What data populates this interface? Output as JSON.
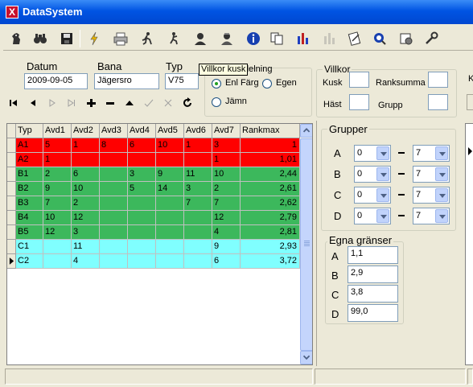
{
  "window": {
    "title": "DataSystem",
    "app_icon": "X"
  },
  "toolbar": {
    "buttons": [
      {
        "icon": "horse-icon",
        "enabled": true
      },
      {
        "icon": "binoculars-icon",
        "enabled": true
      },
      {
        "icon": "save-icon",
        "enabled": true
      },
      {
        "icon": "lightning-icon",
        "enabled": true
      },
      {
        "icon": "printer-icon",
        "enabled": true
      },
      {
        "icon": "runner-icon",
        "enabled": true
      },
      {
        "icon": "runner2-icon",
        "enabled": true
      },
      {
        "icon": "person-icon",
        "enabled": true
      },
      {
        "icon": "person2-icon",
        "enabled": true
      },
      {
        "icon": "info-icon",
        "enabled": true
      },
      {
        "icon": "copy-icon",
        "enabled": true
      },
      {
        "icon": "bar-chart-icon",
        "enabled": true
      },
      {
        "icon": "bar-chart-disabled-icon",
        "enabled": false
      },
      {
        "icon": "edit-doc-icon",
        "enabled": true
      },
      {
        "icon": "search-web-icon",
        "enabled": true
      },
      {
        "icon": "settings-doc-icon",
        "enabled": true
      },
      {
        "icon": "tools-icon",
        "enabled": true
      }
    ]
  },
  "form": {
    "datum_label": "Datum",
    "datum_value": "2009-09-05",
    "bana_label": "Bana",
    "bana_value": "Jägersro",
    "typ_label": "Typ",
    "typ_value": "V75",
    "fordelning_label": "delning",
    "radio_enl_farg": "Enl Färg",
    "radio_egen": "Egen",
    "radio_jamn": "Jämn",
    "tooltip": "Villkor kusk"
  },
  "villkor": {
    "title": "Villkor",
    "kusk": "Kusk",
    "ranksumma": "Ranksumma",
    "hast": "Häst",
    "grupp": "Grupp",
    "k": "K"
  },
  "grid": {
    "headers": [
      "Typ",
      "Avd1",
      "Avd2",
      "Avd3",
      "Avd4",
      "Avd5",
      "Avd6",
      "Avd7",
      "Rankmax"
    ],
    "rows": [
      {
        "cells": [
          "A1",
          "5",
          "1",
          "8",
          "6",
          "10",
          "1",
          "3",
          "1"
        ],
        "color": "#ff0000",
        "current": false
      },
      {
        "cells": [
          "A2",
          "1",
          "",
          "",
          "",
          "",
          "",
          "1",
          "1,01"
        ],
        "color": "#ff0000",
        "current": false
      },
      {
        "cells": [
          "B1",
          "2",
          "6",
          "",
          "3",
          "9",
          "11",
          "10",
          "2,44"
        ],
        "color": "#3cb85c",
        "current": false
      },
      {
        "cells": [
          "B2",
          "9",
          "10",
          "",
          "5",
          "14",
          "3",
          "2",
          "2,61"
        ],
        "color": "#3cb85c",
        "current": false
      },
      {
        "cells": [
          "B3",
          "7",
          "2",
          "",
          "",
          "",
          "7",
          "7",
          "2,62"
        ],
        "color": "#3cb85c",
        "current": false
      },
      {
        "cells": [
          "B4",
          "10",
          "12",
          "",
          "",
          "",
          "",
          "12",
          "2,79"
        ],
        "color": "#3cb85c",
        "current": false
      },
      {
        "cells": [
          "B5",
          "12",
          "3",
          "",
          "",
          "",
          "",
          "4",
          "2,81"
        ],
        "color": "#3cb85c",
        "current": false
      },
      {
        "cells": [
          "C1",
          "",
          "11",
          "",
          "",
          "",
          "",
          "9",
          "2,93"
        ],
        "color": "#80ffff",
        "current": false
      },
      {
        "cells": [
          "C2",
          "",
          "4",
          "",
          "",
          "",
          "",
          "6",
          "3,72"
        ],
        "color": "#80ffff",
        "current": true
      }
    ]
  },
  "grupper": {
    "title": "Grupper",
    "rows": [
      {
        "label": "A",
        "from": "0",
        "to": "7"
      },
      {
        "label": "B",
        "from": "0",
        "to": "7"
      },
      {
        "label": "C",
        "from": "0",
        "to": "7"
      },
      {
        "label": "D",
        "from": "0",
        "to": "7"
      }
    ]
  },
  "egna": {
    "title": "Egna gränser",
    "rows": [
      {
        "label": "A",
        "value": "1,1"
      },
      {
        "label": "B",
        "value": "2,9"
      },
      {
        "label": "C",
        "value": "3,8"
      },
      {
        "label": "D",
        "value": "99,0"
      }
    ]
  }
}
